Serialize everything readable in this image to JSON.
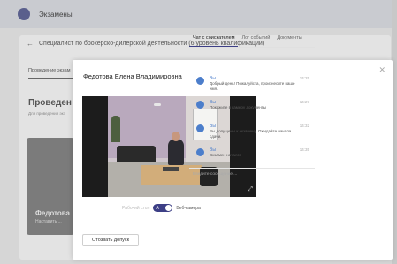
{
  "app": {
    "title": "Экзамены"
  },
  "background": {
    "back_title": "Специалист по брокерско-дилерской деятельности (6 уровень квалификации)",
    "tab_label": "Проведение экзам",
    "heading": "Проведен",
    "subtext": "Для проведения экз",
    "thumb_name": "Федотова",
    "thumb_sub": "Наставить ..."
  },
  "modal": {
    "title": "Федотова Елена Владимировна",
    "toggle_left": "Рабочий стол",
    "toggle_knob": "A",
    "toggle_right": "Веб-камера",
    "recall_button": "Отозвать допуск",
    "tabs": [
      "Чат с соискателем",
      "Лог событий",
      "Документы"
    ],
    "messages": [
      {
        "name": "Вы",
        "time": "14:25",
        "text": "Добрый день! Пожалуйста, произнесите ваше имя."
      },
      {
        "name": "Вы",
        "time": "14:27",
        "text": "Покажите в камеру документы"
      },
      {
        "name": "Вы",
        "time": "14:32",
        "text": "Вы допущены к экзамену. Ожидайте начала сдачи."
      },
      {
        "name": "Вы",
        "time": "14:35",
        "text": "Экзамен начался"
      }
    ],
    "input_placeholder": "Введите сообщение ..."
  },
  "colors": {
    "accent": "#3d3f86",
    "link": "#4c7ecb"
  }
}
